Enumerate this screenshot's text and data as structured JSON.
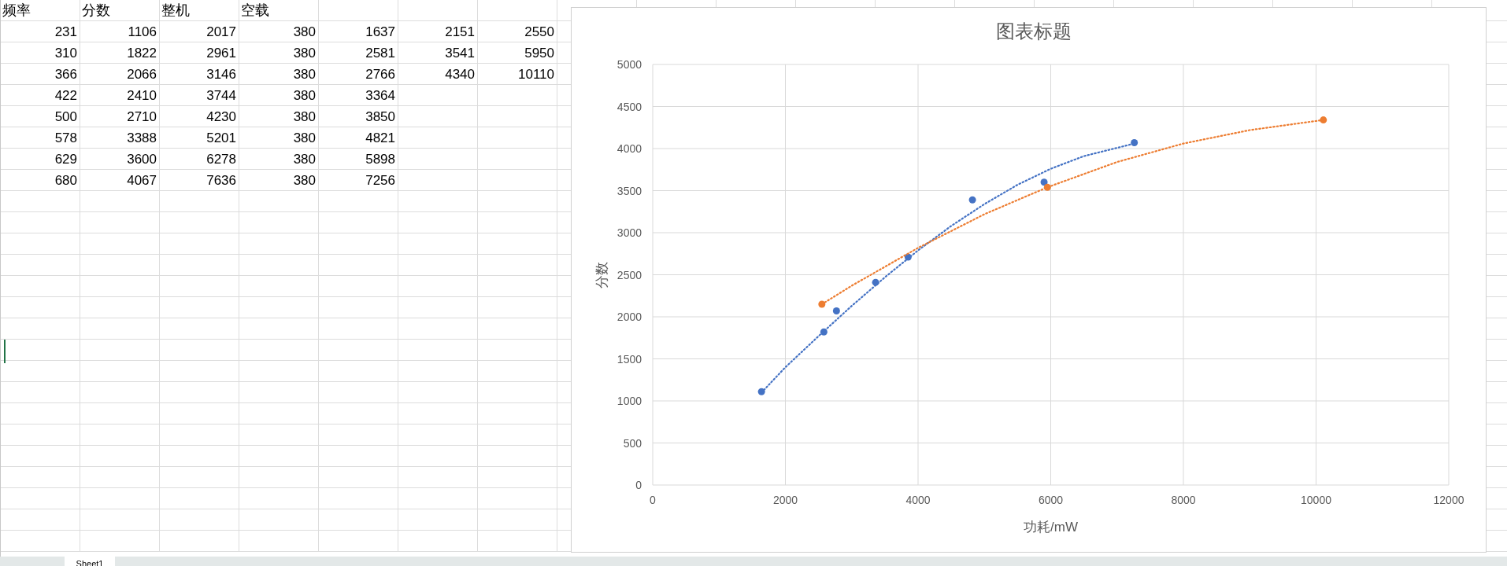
{
  "sheet": {
    "header": [
      "频率",
      "分数",
      "整机",
      "空载"
    ],
    "rows": [
      [
        "231",
        "1106",
        "2017",
        "380",
        "1637",
        "2151",
        "2550"
      ],
      [
        "310",
        "1822",
        "2961",
        "380",
        "2581",
        "3541",
        "5950"
      ],
      [
        "366",
        "2066",
        "3146",
        "380",
        "2766",
        "4340",
        "10110"
      ],
      [
        "422",
        "2410",
        "3744",
        "380",
        "3364"
      ],
      [
        "500",
        "2710",
        "4230",
        "380",
        "3850"
      ],
      [
        "578",
        "3388",
        "5201",
        "380",
        "4821"
      ],
      [
        "629",
        "3600",
        "6278",
        "380",
        "5898"
      ],
      [
        "680",
        "4067",
        "7636",
        "380",
        "7256"
      ]
    ]
  },
  "chart": {
    "chart_data": {
      "type": "scatter",
      "title": "图表标题",
      "xlabel": "功耗/mW",
      "ylabel": "分数",
      "xlim": [
        0,
        12000
      ],
      "ylim": [
        0,
        5000
      ],
      "grid": true,
      "xticks": [
        0,
        2000,
        4000,
        6000,
        8000,
        10000,
        12000
      ],
      "yticks": [
        0,
        500,
        1000,
        1500,
        2000,
        2500,
        3000,
        3500,
        4000,
        4500,
        5000
      ],
      "series": [
        {
          "type": "scatter",
          "color": "#4472c4",
          "x": [
            1640,
            2580,
            2770,
            3360,
            3850,
            4820,
            5900,
            7260
          ],
          "values": [
            1110,
            1820,
            2070,
            2410,
            2710,
            3390,
            3600,
            4070
          ]
        },
        {
          "type": "scatter",
          "color": "#ed7d31",
          "x": [
            2550,
            5950,
            10110
          ],
          "values": [
            2150,
            3540,
            4340
          ]
        },
        {
          "type": "line",
          "line_style": "dotted",
          "color": "#4472c4",
          "x": [
            1640,
            2000,
            2500,
            3000,
            3500,
            4000,
            4500,
            5000,
            5500,
            6000,
            6500,
            7260
          ],
          "values": [
            1100,
            1400,
            1770,
            2130,
            2470,
            2790,
            3080,
            3340,
            3570,
            3760,
            3910,
            4060
          ]
        },
        {
          "type": "line",
          "line_style": "dotted",
          "color": "#ed7d31",
          "x": [
            2550,
            3000,
            4000,
            5000,
            5950,
            7000,
            8000,
            9000,
            10110
          ],
          "values": [
            2150,
            2370,
            2820,
            3220,
            3540,
            3840,
            4060,
            4220,
            4340
          ]
        }
      ]
    }
  },
  "sheet_tabs": [
    {
      "label": "Sheet1",
      "selected": true
    }
  ]
}
